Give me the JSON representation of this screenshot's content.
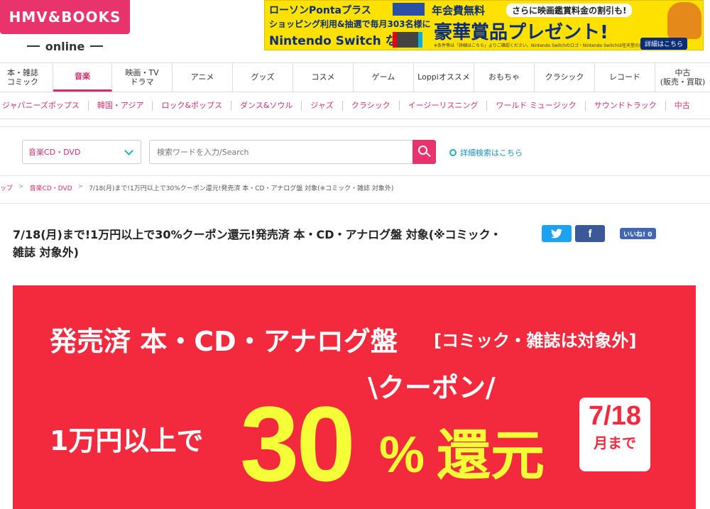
{
  "logo": {
    "brand": "HMV&BOOKS",
    "sub": "online"
  },
  "ad": {
    "line1": "ローソンPontaプラス",
    "line1b": "年会費無料",
    "line1c": "さらに映画鑑賞料金の割引も!",
    "line2": "ショッピング利用&抽選で毎月303名様に",
    "line3": "Nintendo Switch など",
    "big": "豪華賞品プレゼント!",
    "small": "※条件等は「詳細はこちら」よりご確認ください。Nintendo Switchのロゴ・Nintendo Switchは任天堂の商標です。",
    "button": "詳細はこちら"
  },
  "catnav": [
    {
      "label": "本・雑誌\nコミック",
      "active": false
    },
    {
      "label": "音楽",
      "active": true
    },
    {
      "label": "映画・TV\nドラマ",
      "active": false
    },
    {
      "label": "アニメ",
      "active": false
    },
    {
      "label": "グッズ",
      "active": false
    },
    {
      "label": "コスメ",
      "active": false
    },
    {
      "label": "ゲーム",
      "active": false
    },
    {
      "label": "Loppiオススメ",
      "active": false
    },
    {
      "label": "おもちゃ",
      "active": false
    },
    {
      "label": "クラシック",
      "active": false
    },
    {
      "label": "レコード",
      "active": false
    },
    {
      "label": "中古\n(販売・買取)",
      "active": false
    }
  ],
  "subnav": [
    "ジャパニーズポップス",
    "韓国・アジア",
    "ロック&ポップス",
    "ダンス&ソウル",
    "ジャズ",
    "クラシック",
    "イージーリスニング",
    "ワールド ミュージック",
    "サウンドトラック",
    "中古"
  ],
  "search": {
    "category": "音楽CD・DVD",
    "placeholder": "検索ワードを入力/Search",
    "advanced": "詳細検索はこちら"
  },
  "breadcrumb": {
    "home": "ップ",
    "cat": "音楽CD・DVD",
    "current": "7/18(月)まで!1万円以上で30%クーポン還元!発売済 本・CD・アナログ盤 対象(※コミック・雑誌 対象外)"
  },
  "title": "7/18(月)まで!1万円以上で30%クーポン還元!発売済 本・CD・アナログ盤 対象(※コミック・雑誌 対象外)",
  "share": {
    "facebook": "f",
    "like": "いいね! 0"
  },
  "promo": {
    "line1": "発売済 本・CD・アナログ盤",
    "line1_sub": "[コミック・雑誌は対象外]",
    "coupon": "\\クーポン/",
    "min": "1万円以上で",
    "rate": "30",
    "pct": "%",
    "kanji": "還元",
    "date": "7/18",
    "until": "月まで"
  }
}
